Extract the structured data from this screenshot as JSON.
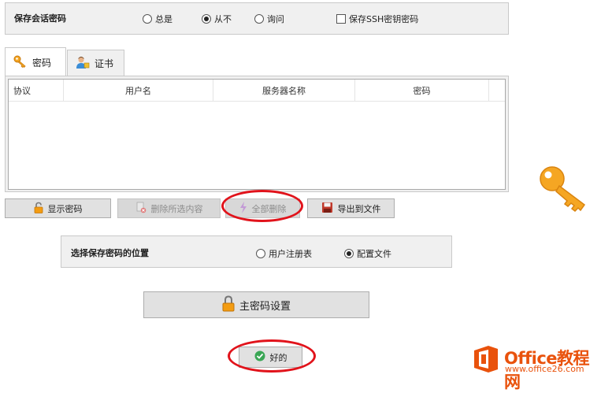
{
  "save_group": {
    "title": "保存会话密码",
    "options": [
      {
        "label": "总是",
        "selected": false
      },
      {
        "label": "从不",
        "selected": true
      },
      {
        "label": "询问",
        "selected": false
      }
    ],
    "ssh_checkbox": {
      "label": "保存SSH密钥密码",
      "checked": false
    }
  },
  "tabs": [
    {
      "label": "密码",
      "active": true,
      "icon": "key-icon"
    },
    {
      "label": "证书",
      "active": false,
      "icon": "user-certificate-icon"
    }
  ],
  "table": {
    "columns": [
      "协议",
      "用户名",
      "服务器名称",
      "密码"
    ],
    "rows": []
  },
  "buttons": {
    "show_password": "显示密码",
    "delete_selected": "删除所选内容",
    "delete_all": "全部删除",
    "export": "导出到文件"
  },
  "location_group": {
    "title": "选择保存密码的位置",
    "options": [
      {
        "label": "用户注册表",
        "selected": false
      },
      {
        "label": "配置文件",
        "selected": true
      }
    ]
  },
  "master_password_button": "主密码设置",
  "ok_button": "好的",
  "watermark": {
    "brand": "Office教程网",
    "url": "www.office26.com"
  },
  "colors": {
    "highlight_ellipse": "#e1131b",
    "key_orange": "#f5a623",
    "watermark_orange": "#e9520c"
  }
}
